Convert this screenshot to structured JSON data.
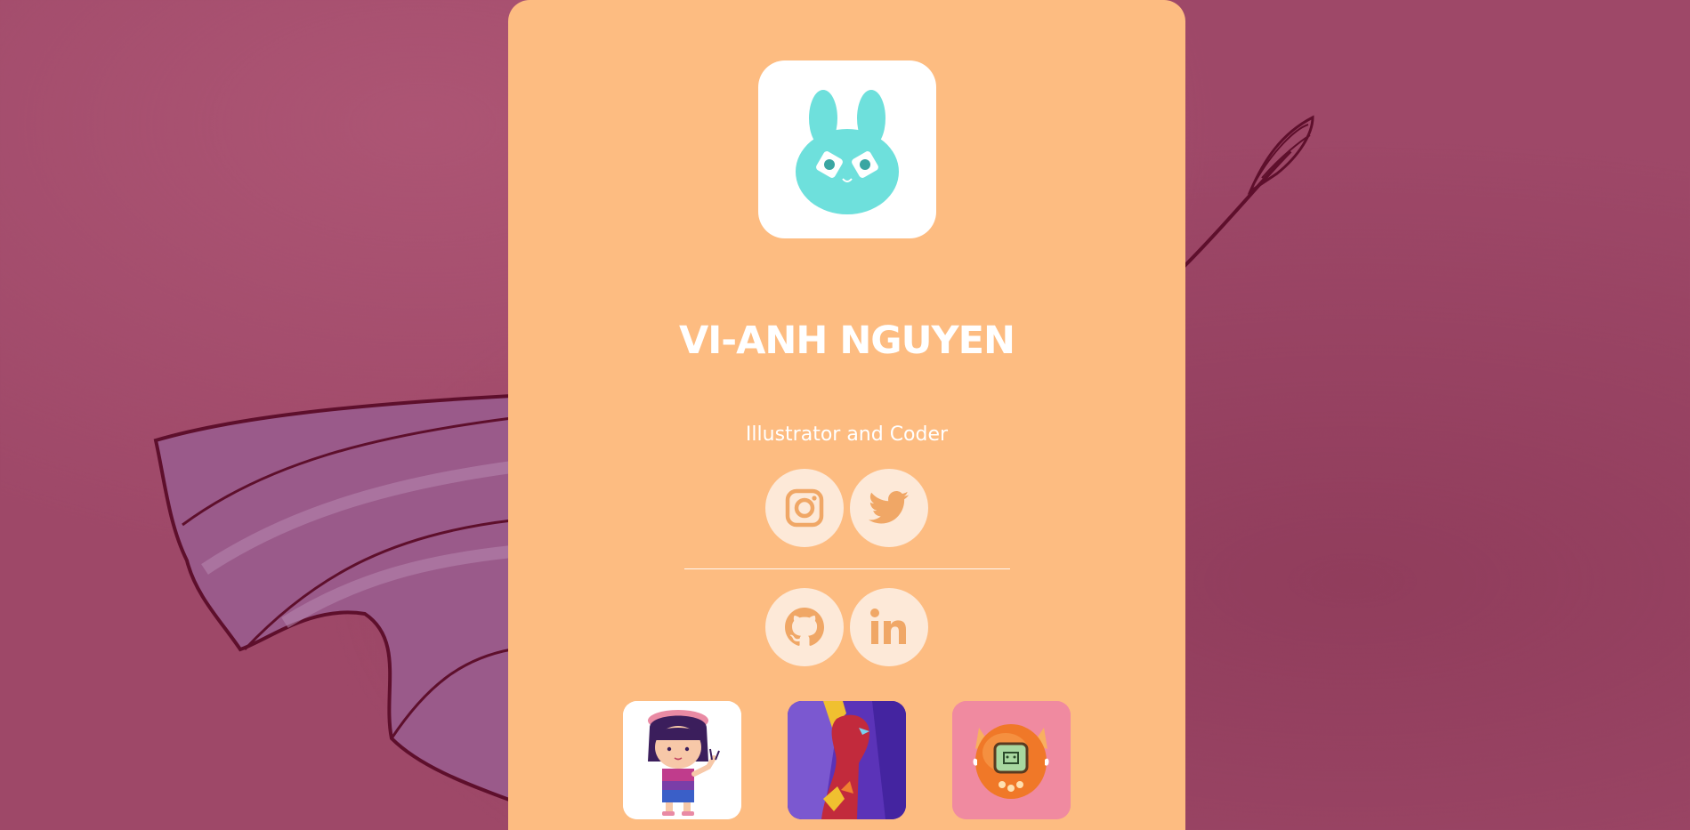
{
  "profile": {
    "name": "VI-ANH NGUYEN",
    "tagline": "Illustrator and Coder",
    "avatar_icon": "bunny-icon"
  },
  "socials_primary": [
    {
      "name": "instagram",
      "icon": "instagram-icon"
    },
    {
      "name": "twitter",
      "icon": "twitter-icon"
    }
  ],
  "socials_secondary": [
    {
      "name": "github",
      "icon": "github-icon"
    },
    {
      "name": "linkedin",
      "icon": "linkedin-icon"
    }
  ],
  "projects": [
    {
      "name": "girl-character-illustration"
    },
    {
      "name": "red-figure-illustration"
    },
    {
      "name": "tamagotchi-illustration"
    }
  ],
  "colors": {
    "background": "#9e4868",
    "card": "#fdbc81",
    "social_button": "#fde9d8",
    "icon": "#f0a766",
    "bunny": "#6ee0dc"
  }
}
